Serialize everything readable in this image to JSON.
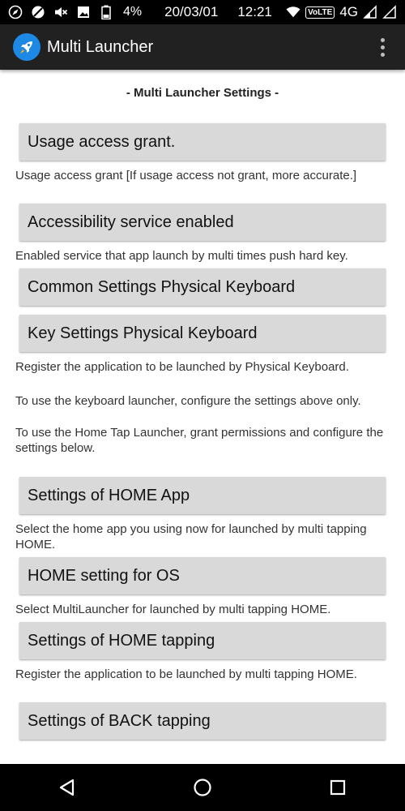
{
  "status_bar": {
    "battery_percent": "4%",
    "date": "20/03/01",
    "time": "12:21",
    "volte": "VoLTE",
    "network": "4G"
  },
  "app_bar": {
    "title": "Multi Launcher",
    "logo_icon": "rocket-icon",
    "menu_icon": "overflow-menu-icon"
  },
  "content": {
    "section_title": "- Multi Launcher Settings -",
    "items": [
      {
        "button": "Usage access grant.",
        "description": "Usage access grant [If usage access not grant, more accurate.]"
      },
      {
        "button": "Accessibility service enabled",
        "description": "Enabled service that app launch by multi times push hard key."
      },
      {
        "button": "Common Settings Physical Keyboard",
        "description": ""
      },
      {
        "button": "Key Settings Physical Keyboard",
        "description": "Register the application to be launched by Physical Keyboard."
      }
    ],
    "info_line1": "To use the keyboard launcher, configure the settings above only.",
    "info_line2": "To use the Home Tap Launcher, grant permissions and configure the settings below.",
    "home_items": [
      {
        "button": "Settings of HOME App",
        "description": "Select the home app you using now for launched by multi tapping HOME."
      },
      {
        "button": "HOME setting for OS",
        "description": "Select MultiLauncher for launched by multi tapping HOME."
      },
      {
        "button": "Settings of HOME tapping",
        "description": "Register the application to be launched by multi tapping HOME."
      },
      {
        "button": "Settings of BACK tapping",
        "description": ""
      }
    ]
  },
  "nav_bar": {
    "back_icon": "back-triangle-icon",
    "home_icon": "home-circle-icon",
    "recents_icon": "recents-square-icon"
  },
  "colors": {
    "app_bar": "#212121",
    "button_bg": "#d9d9d9",
    "logo": "#1e88e5"
  }
}
